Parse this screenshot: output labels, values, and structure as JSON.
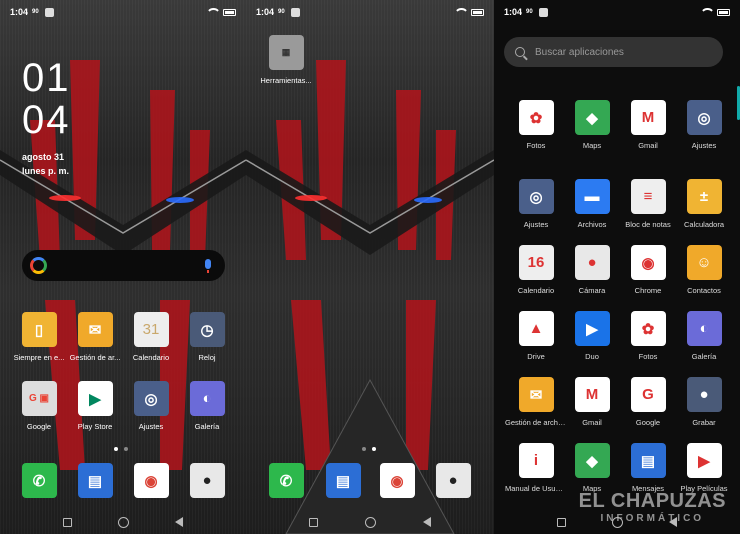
{
  "status_bar": {
    "time": "1:04",
    "net": "90",
    "notification_icon": "notification-icon"
  },
  "home_screen": {
    "clock_hour": "01",
    "clock_minute": "04",
    "date_line1": "agosto 31",
    "date_line2": "lunes p. m.",
    "apps": [
      {
        "label": "Siempre en e...",
        "icon": "phone-icon",
        "color": "#f0b433"
      },
      {
        "label": "Gestión de ar...",
        "icon": "folder-icon",
        "color": "#f0a92a"
      },
      {
        "label": "Calendario",
        "icon": "calendar-icon",
        "color": "#eeeeee"
      },
      {
        "label": "Reloj",
        "icon": "clock-icon",
        "color": "#4a5a78"
      },
      {
        "label": "Google",
        "icon": "google-folder-icon",
        "color": "#dddddd"
      },
      {
        "label": "Play Store",
        "icon": "play-store-icon",
        "color": "#ffffff"
      },
      {
        "label": "Ajustes",
        "icon": "settings-icon",
        "color": "#4a5f8a"
      },
      {
        "label": "Galería",
        "icon": "gallery-icon",
        "color": "#6b6bd8"
      }
    ],
    "dock": [
      {
        "name": "phone-icon",
        "color": "#2db84c"
      },
      {
        "name": "messages-icon",
        "color": "#2c6ed5"
      },
      {
        "name": "chrome-icon",
        "color": "#ffffff"
      },
      {
        "name": "camera-icon",
        "color": "#e8e8e8"
      }
    ]
  },
  "second_screen": {
    "folder_label": "Herramientas...",
    "dock": [
      {
        "name": "phone-icon",
        "color": "#2db84c"
      },
      {
        "name": "messages-icon",
        "color": "#2c6ed5"
      },
      {
        "name": "chrome-icon",
        "color": "#ffffff"
      },
      {
        "name": "camera-icon",
        "color": "#e8e8e8"
      }
    ]
  },
  "app_drawer": {
    "search_placeholder": "Buscar aplicaciones",
    "apps": [
      {
        "label": "Fotos",
        "icon": "photos-icon",
        "color": "#ffffff"
      },
      {
        "label": "Maps",
        "icon": "maps-icon",
        "color": "#34a853"
      },
      {
        "label": "Gmail",
        "icon": "gmail-icon",
        "color": "#ffffff"
      },
      {
        "label": "Ajustes",
        "icon": "settings-icon",
        "color": "#4a5f8a"
      },
      {
        "label": "Ajustes",
        "icon": "settings-icon",
        "color": "#4a5f8a"
      },
      {
        "label": "Archivos",
        "icon": "files-icon",
        "color": "#2c7bf2"
      },
      {
        "label": "Bloc de notas",
        "icon": "notes-icon",
        "color": "#eeeeee"
      },
      {
        "label": "Calculadora",
        "icon": "calculator-icon",
        "color": "#f0b433"
      },
      {
        "label": "Calendario",
        "icon": "calendar-icon",
        "color": "#eeeeee"
      },
      {
        "label": "Cámara",
        "icon": "camera-icon",
        "color": "#e8e8e8"
      },
      {
        "label": "Chrome",
        "icon": "chrome-icon",
        "color": "#ffffff"
      },
      {
        "label": "Contactos",
        "icon": "contacts-icon",
        "color": "#f0a92a"
      },
      {
        "label": "Drive",
        "icon": "drive-icon",
        "color": "#ffffff"
      },
      {
        "label": "Duo",
        "icon": "duo-icon",
        "color": "#1a73e8"
      },
      {
        "label": "Fotos",
        "icon": "photos-icon",
        "color": "#ffffff"
      },
      {
        "label": "Galería",
        "icon": "gallery-icon",
        "color": "#6b6bd8"
      },
      {
        "label": "Gestión de archiv...",
        "icon": "folder-icon",
        "color": "#f0a92a"
      },
      {
        "label": "Gmail",
        "icon": "gmail-icon",
        "color": "#ffffff"
      },
      {
        "label": "Google",
        "icon": "google-icon",
        "color": "#ffffff"
      },
      {
        "label": "Grabar",
        "icon": "record-icon",
        "color": "#4a5a78"
      },
      {
        "label": "Manual de Usuario",
        "icon": "manual-icon",
        "color": "#ffffff"
      },
      {
        "label": "Maps",
        "icon": "maps-icon",
        "color": "#34a853"
      },
      {
        "label": "Mensajes",
        "icon": "messages-icon",
        "color": "#2c6ed5"
      },
      {
        "label": "Play Películas",
        "icon": "play-movies-icon",
        "color": "#ffffff"
      }
    ]
  },
  "watermark": {
    "line1": "EL CHAPUZAS",
    "line2": "INFORMÁTICO"
  }
}
